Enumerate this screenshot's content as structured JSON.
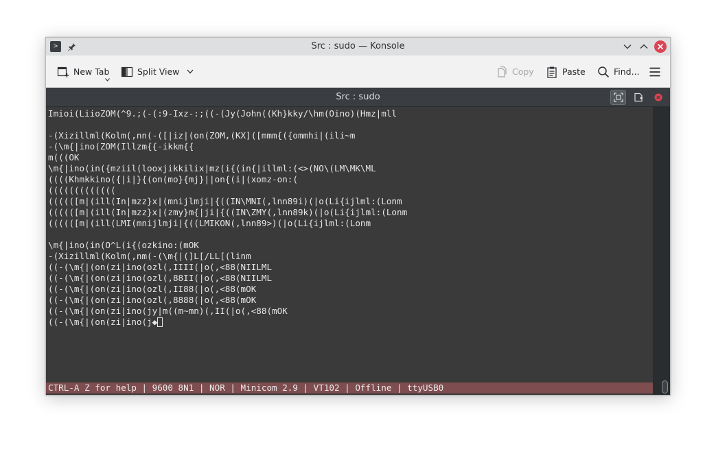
{
  "window": {
    "title": "Src : sudo — Konsole"
  },
  "toolbar": {
    "new_tab": "New Tab",
    "split_view": "Split View",
    "copy": "Copy",
    "paste": "Paste",
    "find": "Find..."
  },
  "tab": {
    "title": "Src : sudo"
  },
  "terminal": {
    "lines": [
      "Imioi(LiioZOM(^9.;(-(:9-Ixz-:;((-(Jy(John((Kh}kky/\\hm(Oino)(Hmz|mll",
      "",
      "-(Xizillml(Kolm(,nn(-([|iz|(on(ZOM,(KX]([mmm{({ommhi|(ili~m",
      "-(\\m{|ino(ZOM(Illzm{{-ikkm{{",
      "m(((OK",
      "\\m{|ino(in({mziil(looxjikkilix|mz(i{(in{|illml:(<>(NO\\(LM\\MK\\ML",
      "((((Khmkkino({|i|}{(on(mo}{mj}||on{(i|(xomz-on:(",
      "(((((((((((((",
      "((((([m|(ill(In|mzz}x|(mnijlmji|{((IN\\MNI(,lnn89i)(|o(Li{ijlml:(Lonm",
      "((((([m|(ill(In|mzz}x|(zmy}m{|ji|{((IN\\ZMY(,lnn89k)(|o(Li{ijlml:(Lonm",
      "((((([m|(ill(LMI(mnijlmji|{((LMIKON(,lnn89>)(|o(Li{ijlml:(Lonm",
      "",
      "\\m{|ino(in(O^L(i{(ozkino:(mOK",
      "-(Xizillml(Kolm(,nm(-(\\m{|(]L[/LL[(linm",
      "((-(\\m{|(on(zi|ino(ozl(,IIII(|o(,<88(NIILML",
      "((-(\\m{|(on(zi|ino(ozl(,88II(|o(,<88(NIILML",
      "((-(\\m{|(on(zi|ino(ozl(,II88(|o(,<88(mOK",
      "((-(\\m{|(on(zi|ino(ozl(,8888(|o(,<88(mOK",
      "((-(\\m{|(on(zi|ino(jy|m((m~mn)(,II(|o(,<88(mOK",
      "((-(\\m{|(on(zi|ino(j◆"
    ],
    "status_line": "CTRL-A Z for help | 9600 8N1 | NOR | Minicom 2.9 | VT102 | Offline | ttyUSB0"
  },
  "colors": {
    "terminal_bg": "#3a3a3a",
    "terminal_fg": "#e6e6e6",
    "status_bg": "#7e4d4f",
    "close_button": "#da4453"
  },
  "icons": {
    "app": "terminal-icon",
    "pin": "pin-icon",
    "minimize": "chevron-down-icon",
    "maximize": "chevron-up-icon",
    "close": "close-icon",
    "new_tab": "new-tab-icon",
    "split_view": "split-view-icon",
    "copy": "copy-icon",
    "paste": "paste-icon",
    "find": "search-icon",
    "menu": "hamburger-menu-icon"
  }
}
